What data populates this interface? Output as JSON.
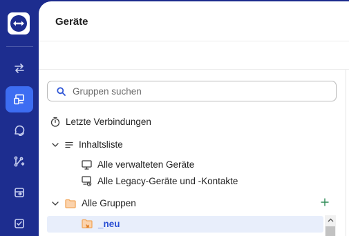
{
  "header": {
    "title": "Geräte"
  },
  "search": {
    "placeholder": "Gruppen suchen"
  },
  "tree": {
    "recent": "Letzte Verbindungen",
    "contents": "Inhaltsliste",
    "managed": "Alle verwalteten Geräte",
    "legacy": "Alle Legacy-Geräte und -Kontakte",
    "all_groups": "Alle Gruppen",
    "group_neu": "_neu"
  },
  "icons": {
    "rail": [
      "connect-arrows-icon",
      "devices-icon",
      "chat-icon",
      "integrations-icon",
      "remote-management-icon",
      "tasks-icon"
    ],
    "brand": "teamviewer-logo"
  },
  "colors": {
    "rail_bg": "#1d2d8f",
    "rail_active": "#3d6df2",
    "accent": "#2a4fd4",
    "folder": "#f2a65a",
    "add": "#2e8b57"
  }
}
